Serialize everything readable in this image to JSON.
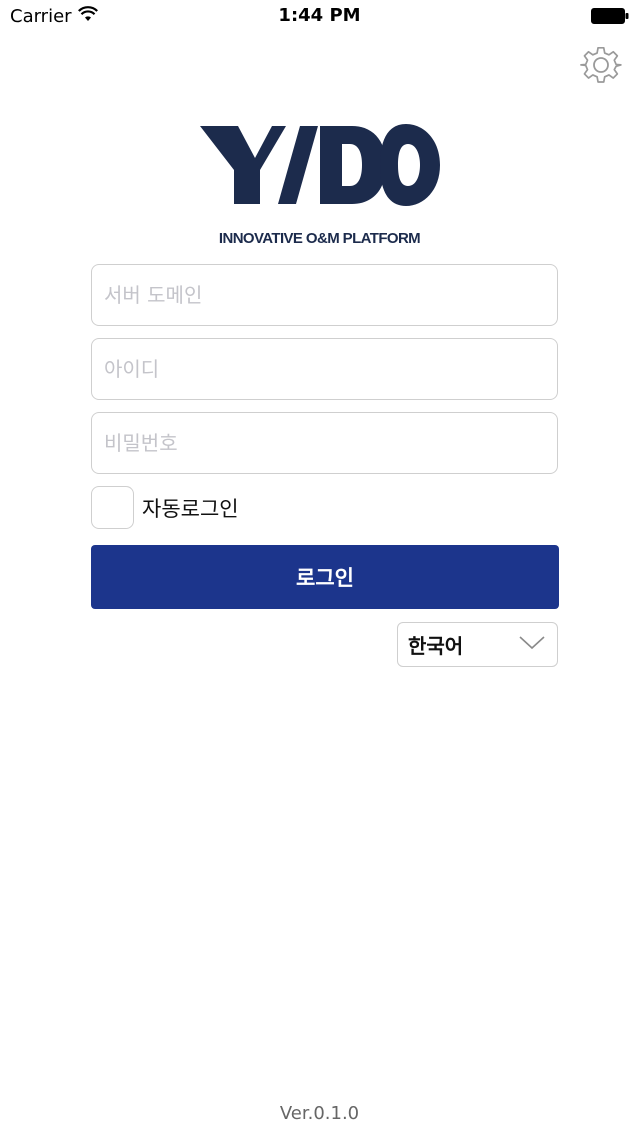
{
  "status_bar": {
    "carrier": "Carrier",
    "time": "1:44 PM",
    "wifi_icon": "wifi-icon",
    "battery_icon": "battery-icon"
  },
  "header": {
    "settings_icon": "gear-icon",
    "logo_text": "YIDO",
    "tagline": "INNOVATIVE O&M PLATFORM"
  },
  "form": {
    "domain_placeholder": "서버 도메인",
    "domain_value": "",
    "id_placeholder": "아이디",
    "id_value": "",
    "password_placeholder": "비밀번호",
    "password_value": "",
    "auto_login_label": "자동로그인",
    "auto_login_checked": false,
    "login_button": "로그인"
  },
  "language": {
    "selected": "한국어",
    "chevron_icon": "chevron-down-icon"
  },
  "footer": {
    "version": "Ver.0.1.0"
  },
  "colors": {
    "primary": "#1c358c",
    "logo": "#1c2b4c",
    "border": "#cfcfcf",
    "placeholder": "#c4c4ca"
  }
}
